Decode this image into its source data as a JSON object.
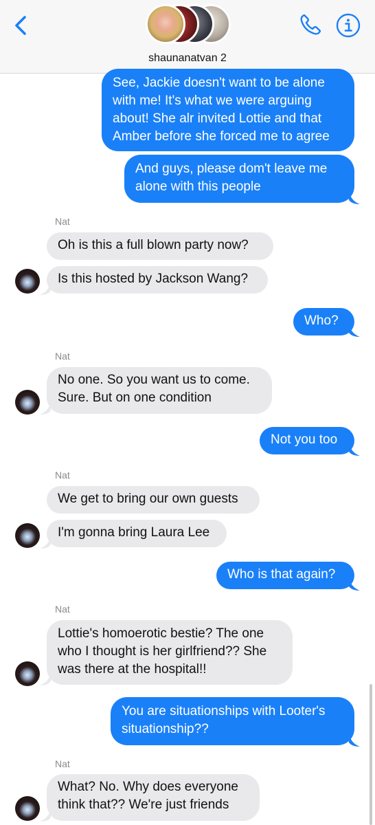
{
  "header": {
    "title": "shaunanatvan 2",
    "accent": "#1a80f8"
  },
  "messages": [
    {
      "from": "me",
      "lines": [
        "See, Jackie doesn't want to be alone",
        "with me! It's what we were arguing",
        "about! She alr invited Lottie and that",
        "Amber before she forced me to agree"
      ]
    },
    {
      "from": "me",
      "lines": [
        "And guys, please dom't leave me",
        "alone with this people"
      ]
    },
    {
      "from": "Nat",
      "lines": [
        "Oh is this a full blown party now?"
      ]
    },
    {
      "from": "Nat",
      "lines": [
        "Is this hosted by Jackson Wang?"
      ]
    },
    {
      "from": "me",
      "lines": [
        "Who?"
      ]
    },
    {
      "from": "Nat",
      "lines": [
        "No one. So you want us to come.",
        "Sure. But on one condition"
      ]
    },
    {
      "from": "me",
      "lines": [
        "Not you too"
      ]
    },
    {
      "from": "Nat",
      "lines": [
        "We get to bring our own guests"
      ]
    },
    {
      "from": "Nat",
      "lines": [
        "I'm gonna bring Laura Lee"
      ]
    },
    {
      "from": "me",
      "lines": [
        "Who is that again?"
      ]
    },
    {
      "from": "Nat",
      "lines": [
        "Lottie's homoerotic bestie? The one",
        "who I thought is her girlfriend?? She",
        "was there at the hospital!!"
      ]
    },
    {
      "from": "me",
      "lines": [
        "You are situationships with Looter's",
        "situationship??"
      ]
    },
    {
      "from": "Nat",
      "lines": [
        "What? No. Why does everyone",
        "think that?? We're just friends"
      ]
    }
  ],
  "sender_labels": [
    "Nat",
    "Nat",
    "Nat",
    "Nat",
    "Nat"
  ],
  "icons": {
    "back": "chevron-left-icon",
    "call": "phone-icon",
    "info": "info-icon"
  }
}
